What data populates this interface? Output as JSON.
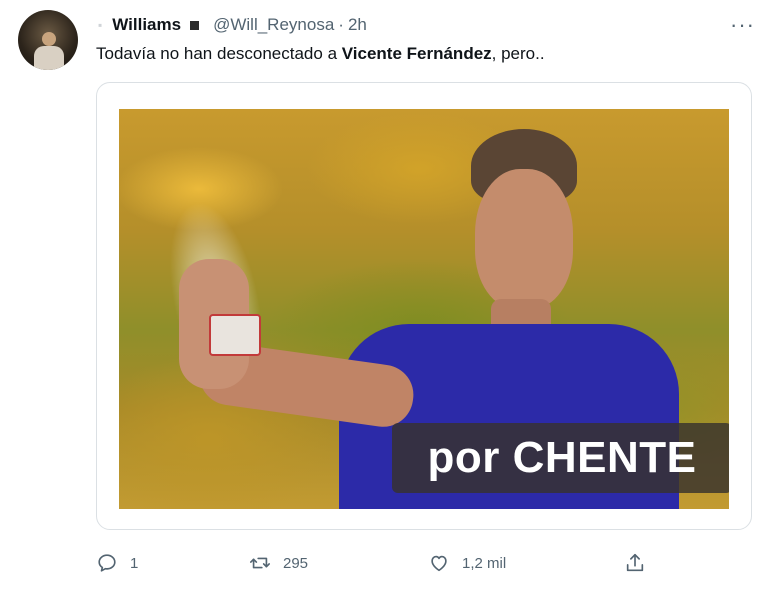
{
  "tweet": {
    "author_name": "Williams",
    "handle": "@Will_Reynosa",
    "separator": "·",
    "time": "2h",
    "text_before": "Todavía no han desconectado a ",
    "text_bold": "Vicente Fernández",
    "text_after": ", pero..",
    "media": {
      "caption": "por CHENTE"
    },
    "actions": {
      "reply_count": "1",
      "retweet_count": "295",
      "like_count": "1,2 mil"
    }
  },
  "icons": {
    "more": "more-options-icon",
    "reply": "reply-icon",
    "retweet": "retweet-icon",
    "like": "heart-icon",
    "share": "share-icon"
  },
  "colors": {
    "text_primary": "#0f1419",
    "text_secondary": "#536471",
    "caption_bg": "#37322d",
    "shirt": "#2c2aa8"
  }
}
